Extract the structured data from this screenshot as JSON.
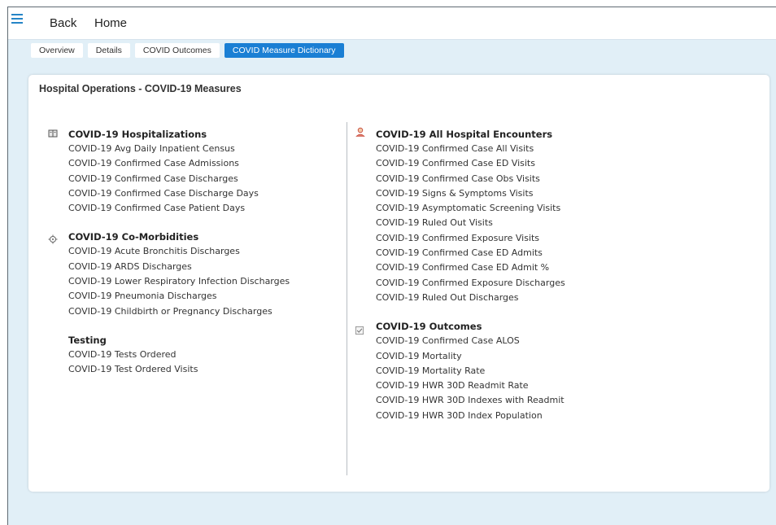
{
  "header": {
    "back_label": "Back",
    "home_label": "Home"
  },
  "tabs": [
    {
      "label": "Overview"
    },
    {
      "label": "Details"
    },
    {
      "label": "COVID Outcomes"
    },
    {
      "label": "COVID Measure Dictionary",
      "active": true
    }
  ],
  "card": {
    "title": "Hospital Operations - COVID-19 Measures"
  },
  "left_column": [
    {
      "icon": "book-icon",
      "title": "COVID-19 Hospitalizations",
      "items": [
        "COVID-19 Avg Daily Inpatient Census",
        "COVID-19 Confirmed Case Admissions",
        "COVID-19 Confirmed Case Discharges",
        "COVID-19 Confirmed Case Discharge Days",
        "COVID-19 Confirmed Case Patient Days"
      ]
    },
    {
      "icon": "virus-icon",
      "title": "COVID-19 Co-Morbidities",
      "items": [
        "COVID-19 Acute Bronchitis Discharges",
        "COVID-19 ARDS Discharges",
        "COVID-19 Lower Respiratory Infection Discharges",
        "COVID-19 Pneumonia Discharges",
        "COVID-19 Childbirth or Pregnancy Discharges"
      ]
    },
    {
      "icon": "",
      "title": "Testing",
      "items": [
        "COVID-19 Tests Ordered",
        "COVID-19 Test Ordered Visits"
      ]
    }
  ],
  "right_column": [
    {
      "icon": "person-icon",
      "title": "COVID-19 All Hospital Encounters",
      "items": [
        "COVID-19 Confirmed Case All Visits",
        "COVID-19 Confirmed Case ED Visits",
        "COVID-19 Confirmed Case Obs Visits",
        "COVID-19 Signs & Symptoms Visits",
        "COVID-19 Asymptomatic Screening Visits",
        "COVID-19 Ruled Out Visits",
        "COVID-19 Confirmed Exposure Visits",
        "COVID-19 Confirmed Case ED Admits",
        "COVID-19 Confirmed Case ED Admit %",
        "COVID-19 Confirmed Exposure Discharges",
        "COVID-19 Ruled Out Discharges"
      ]
    },
    {
      "icon": "checkbox-icon",
      "title": "COVID-19 Outcomes",
      "items": [
        "COVID-19 Confirmed Case ALOS",
        "COVID-19 Mortality",
        "COVID-19 Mortality Rate",
        "COVID-19 HWR 30D Readmit Rate",
        "COVID-19 HWR 30D Indexes with Readmit",
        "COVID-19 HWR 30D Index Population"
      ]
    }
  ],
  "colors": {
    "accent": "#1a7fd4",
    "background": "#e1eff7",
    "menu_icon": "#2585c7"
  }
}
